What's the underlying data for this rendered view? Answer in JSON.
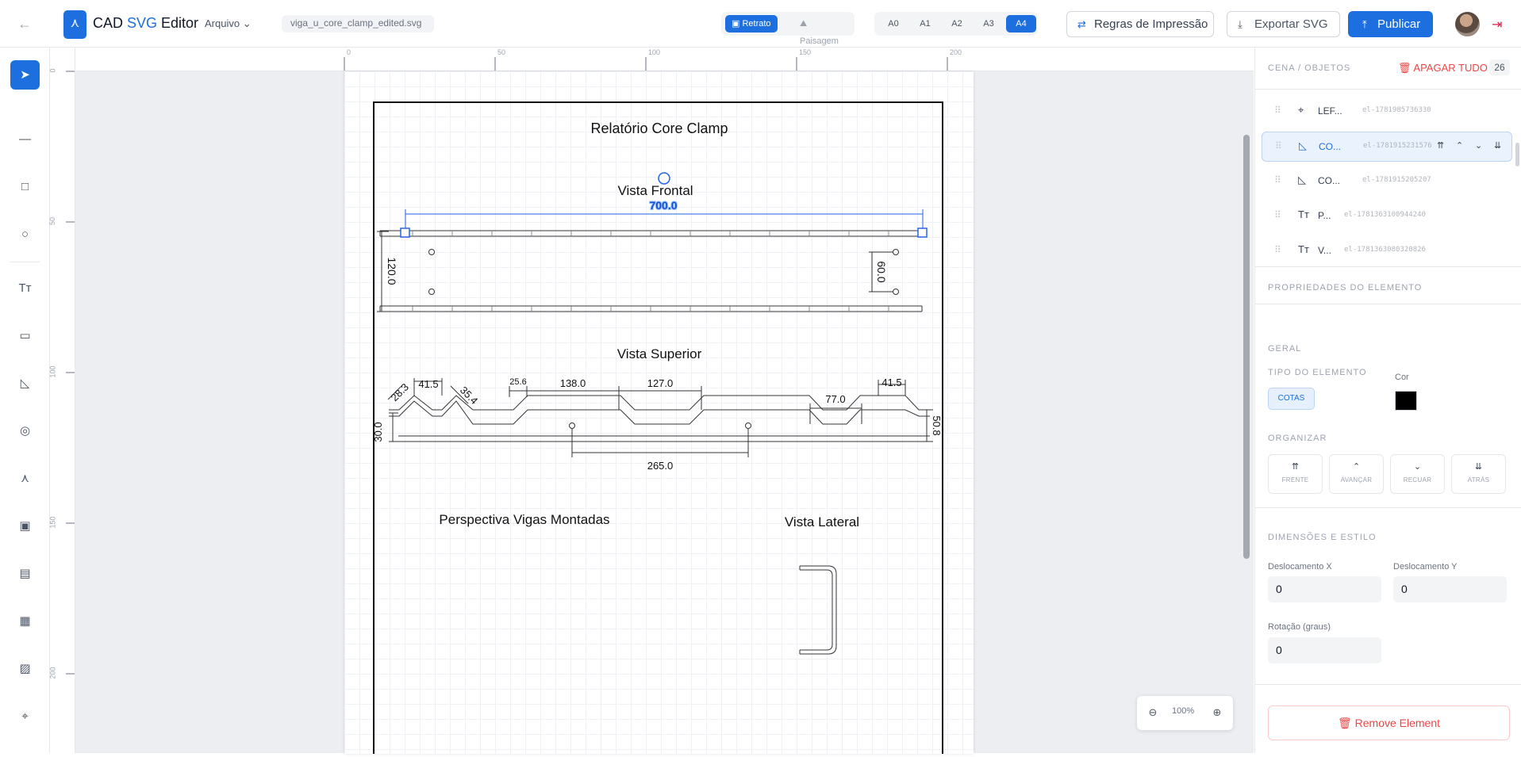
{
  "header": {
    "back_icon": "arrow-left-icon",
    "logo_glyph": "⋏",
    "brand_prefix": "CAD ",
    "brand_accent": "SVG",
    "brand_suffix": " Editor",
    "menu_arquivo": "Arquivo",
    "filename": "viga_u_core_clamp_edited.svg",
    "orientation": {
      "portrait": "Retrato",
      "landscape": "Paisagem",
      "selected": "Retrato"
    },
    "page_sizes": [
      "A0",
      "A1",
      "A2",
      "A3",
      "A4"
    ],
    "page_size_selected": "A4",
    "print_rules": "Regras de Impressão",
    "export_svg": "Exportar SVG",
    "publish": "Publicar",
    "accent_color": "#1d6fe0"
  },
  "toolbar": [
    "select",
    "line",
    "rectangle",
    "circle",
    "text",
    "ruler",
    "angle",
    "target",
    "compass",
    "comment",
    "layout",
    "grid",
    "image",
    "scan"
  ],
  "rulers": {
    "horizontal": [
      "0",
      "50",
      "100",
      "150",
      "200"
    ],
    "vertical": [
      "0",
      "50",
      "100",
      "150",
      "200"
    ]
  },
  "drawing": {
    "title": "Relatório Core Clamp",
    "vista_frontal": "Vista Frontal",
    "vista_superior": "Vista Superior",
    "perspectiva": "Perspectiva Vigas Montadas",
    "vista_lateral": "Vista Lateral",
    "selected_dim": "700.0",
    "dims_frontal": {
      "height": "120.0",
      "hole_spacing": "60.0"
    },
    "dims_superior": {
      "a": "41.5",
      "b": "28.3",
      "c": "35.4",
      "d": "25.6",
      "e": "138.0",
      "f": "127.0",
      "g": "77.0",
      "h": "41.5",
      "i": "30.0",
      "j": "50.8",
      "k": "265.0"
    }
  },
  "zoom": {
    "value": "100%"
  },
  "panel": {
    "scene_header": "CENA / OBJETOS",
    "clear_all": "APAGAR TUDO",
    "count": "26",
    "objects": [
      {
        "icon": "scan-icon",
        "name": "LEF...",
        "id": "el-1781985736330",
        "selected": false
      },
      {
        "icon": "angle-icon",
        "name": "CO...",
        "id": "el-1781915231576",
        "selected": true
      },
      {
        "icon": "angle-icon",
        "name": "CO...",
        "id": "el-1781915205207",
        "selected": false
      },
      {
        "icon": "text-icon",
        "name": "P...",
        "id": "el-1781363100944240",
        "selected": false
      },
      {
        "icon": "text-icon",
        "name": "V...",
        "id": "el-1781363080320826",
        "selected": false
      }
    ],
    "props_header": "PROPRIEDADES DO ELEMENTO",
    "geral": "GERAL",
    "tipo_label": "TIPO DO ELEMENTO",
    "tipo_value": "COTAS",
    "cor_label": "Cor",
    "cor_value": "#000000",
    "organizar": "ORGANIZAR",
    "organize": [
      "FRENTE",
      "AVANÇAR",
      "RECUAR",
      "ATRÁS"
    ],
    "dims_header": "DIMENSÕES E ESTILO",
    "offset_x_label": "Deslocamento X",
    "offset_x": "0",
    "offset_y_label": "Deslocamento Y",
    "offset_y": "0",
    "rotation_label": "Rotação (graus)",
    "rotation": "0",
    "remove": "Remove Element"
  }
}
